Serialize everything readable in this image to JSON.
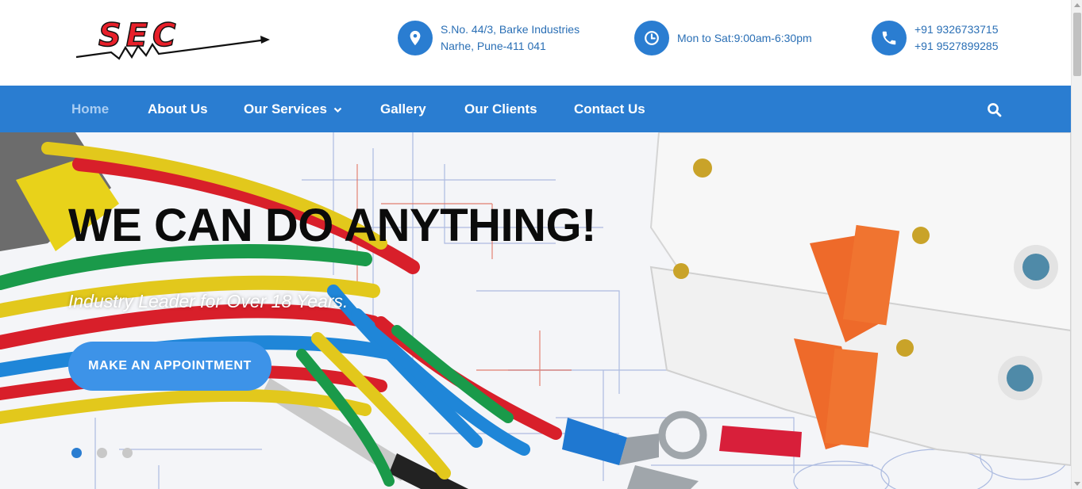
{
  "header": {
    "logo_text": "SEC",
    "address": {
      "icon": "location-pin-icon",
      "line1": "S.No. 44/3, Barke Industries",
      "line2": "Narhe, Pune-411 041"
    },
    "hours": {
      "icon": "clock-icon",
      "text": "Mon to Sat:9:00am-6:30pm"
    },
    "phone": {
      "icon": "phone-icon",
      "line1": "+91 9326733715",
      "line2": "+91 9527899285"
    }
  },
  "nav": {
    "items": [
      {
        "label": "Home",
        "active": true
      },
      {
        "label": "About Us"
      },
      {
        "label": "Our Services",
        "has_dropdown": true
      },
      {
        "label": "Gallery"
      },
      {
        "label": "Our Clients"
      },
      {
        "label": "Contact Us"
      }
    ],
    "search_icon": "search-icon"
  },
  "hero": {
    "title": "WE CAN DO ANYTHING!",
    "subtitle": "Industry Leader for Over 18 Years.",
    "button_label": "MAKE AN APPOINTMENT",
    "slides": 3,
    "active_slide": 1
  },
  "colors": {
    "brand_blue": "#2a7dd1",
    "button_blue": "#3d93e8",
    "logo_red": "#e8202a",
    "header_text": "#2a6fb5"
  }
}
